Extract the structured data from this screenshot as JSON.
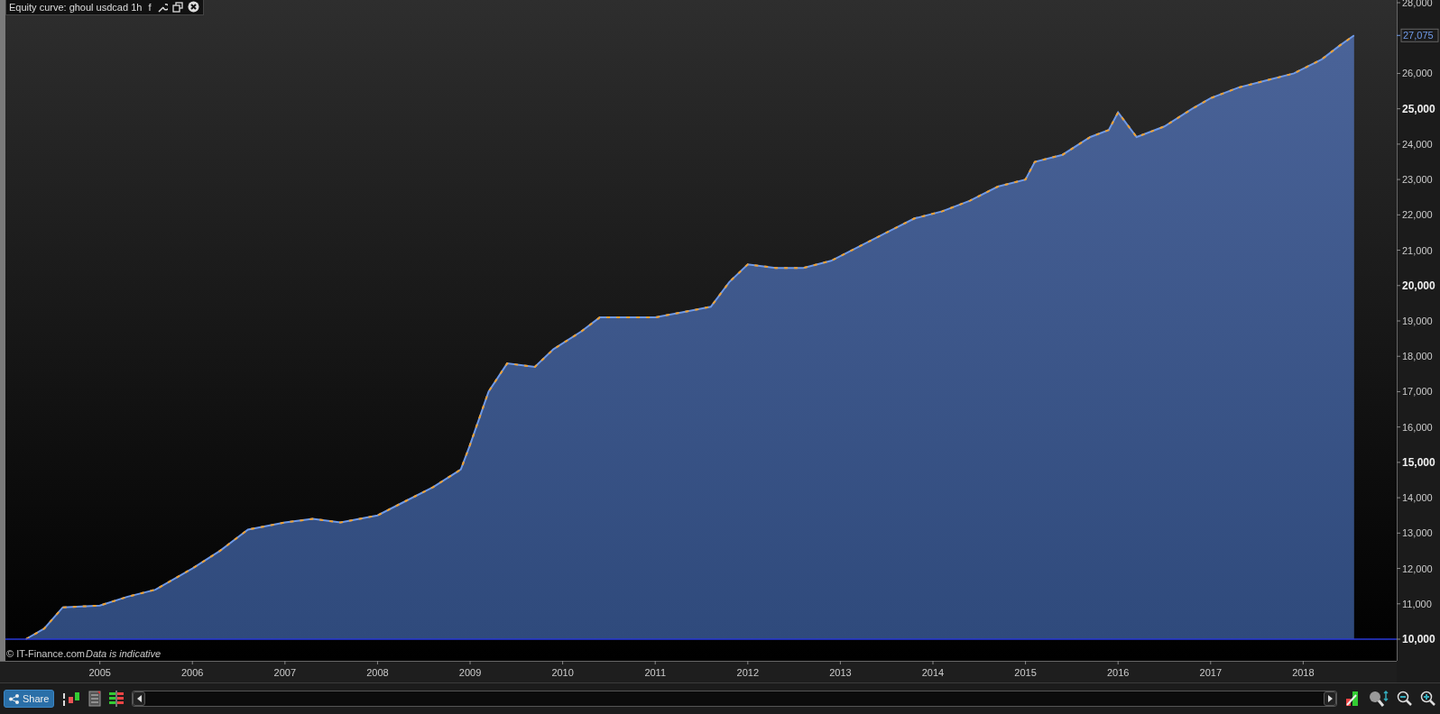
{
  "window": {
    "title": "Equity curve: ghoul usdcad 1h",
    "buttons": [
      "f"
    ]
  },
  "chart": {
    "chart_data": {
      "type": "area",
      "x": [
        2004.2,
        2004.4,
        2004.6,
        2005,
        2005.3,
        2005.6,
        2006,
        2006.3,
        2006.6,
        2007,
        2007.3,
        2007.6,
        2008,
        2008.3,
        2008.6,
        2008.9,
        2009,
        2009.2,
        2009.4,
        2009.7,
        2009.9,
        2010.2,
        2010.4,
        2010.7,
        2011,
        2011.3,
        2011.6,
        2011.8,
        2012,
        2012.3,
        2012.6,
        2012.9,
        2013.2,
        2013.5,
        2013.8,
        2014.1,
        2014.4,
        2014.7,
        2015,
        2015.1,
        2015.4,
        2015.7,
        2015.9,
        2016,
        2016.2,
        2016.5,
        2016.8,
        2017,
        2017.3,
        2017.6,
        2017.9,
        2018.2,
        2018.4,
        2018.55
      ],
      "series": [
        {
          "color": "#6f9ae8",
          "values": [
            10000,
            10300,
            10900,
            10950,
            11200,
            11400,
            12000,
            12500,
            13100,
            13300,
            13400,
            13300,
            13500,
            13900,
            14300,
            14800,
            15500,
            17000,
            17800,
            17700,
            18200,
            18700,
            19100,
            19100,
            19100,
            19250,
            19400,
            20100,
            20600,
            20500,
            20500,
            20700,
            21100,
            21500,
            21900,
            22100,
            22400,
            22800,
            23000,
            23500,
            23700,
            24200,
            24400,
            24900,
            24200,
            24500,
            25000,
            25300,
            25600,
            25800,
            26000,
            26400,
            26800,
            27075
          ]
        }
      ],
      "xlim": [
        2003.98,
        2019.01
      ],
      "ylim": [
        10000,
        28000
      ],
      "xticks": [
        2005,
        2006,
        2007,
        2008,
        2009,
        2010,
        2011,
        2012,
        2013,
        2014,
        2015,
        2016,
        2017,
        2018
      ],
      "yticks": [
        {
          "value": 10000,
          "label": "10,000"
        },
        {
          "value": 11000,
          "label": "11,000"
        },
        {
          "value": 12000,
          "label": "12,000"
        },
        {
          "value": 13000,
          "label": "13,000"
        },
        {
          "value": 14000,
          "label": "14,000"
        },
        {
          "value": 15000,
          "label": "15,000"
        },
        {
          "value": 16000,
          "label": "16,000"
        },
        {
          "value": 17000,
          "label": "17,000"
        },
        {
          "value": 18000,
          "label": "18,000"
        },
        {
          "value": 19000,
          "label": "19,000"
        },
        {
          "value": 20000,
          "label": "20,000"
        },
        {
          "value": 21000,
          "label": "21,000"
        },
        {
          "value": 22000,
          "label": "22,000"
        },
        {
          "value": 23000,
          "label": "23,000"
        },
        {
          "value": 24000,
          "label": "24,000"
        },
        {
          "value": 25000,
          "label": "25,000"
        },
        {
          "value": 26000,
          "label": "26,000"
        },
        {
          "value": 28000,
          "label": "28,000"
        }
      ]
    },
    "last_value_label": "27,075",
    "copyright": "© IT-Finance.com",
    "disclaimer": "Data is indicative"
  },
  "toolbar": {
    "share_button": "Share"
  }
}
